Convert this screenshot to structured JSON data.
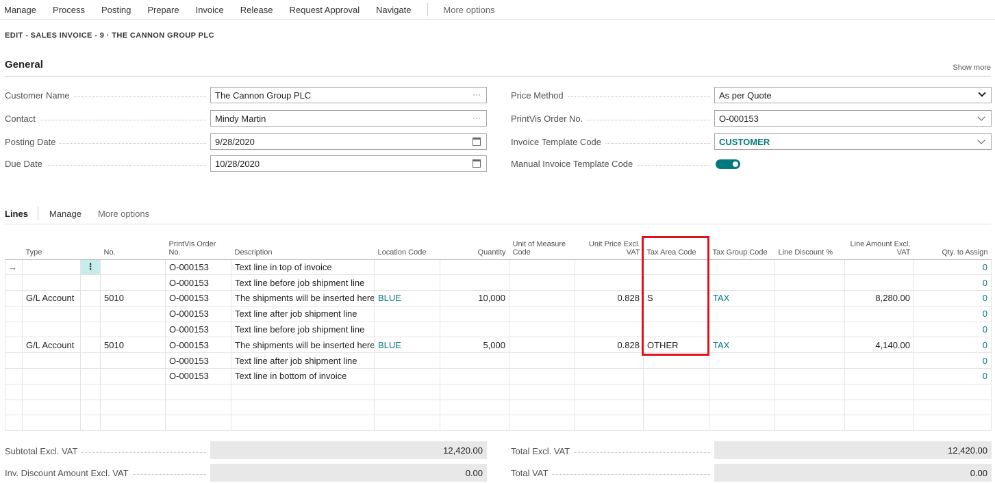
{
  "actions": [
    "Manage",
    "Process",
    "Posting",
    "Prepare",
    "Invoice",
    "Release",
    "Request Approval",
    "Navigate"
  ],
  "more_options": "More options",
  "page_title": "EDIT - SALES INVOICE - 9 · THE CANNON GROUP PLC",
  "general": {
    "title": "General",
    "show_more": "Show more",
    "customer_name": {
      "label": "Customer Name",
      "value": "The Cannon Group PLC"
    },
    "contact": {
      "label": "Contact",
      "value": "Mindy Martin"
    },
    "posting_date": {
      "label": "Posting Date",
      "value": "9/28/2020"
    },
    "due_date": {
      "label": "Due Date",
      "value": "10/28/2020"
    },
    "price_method": {
      "label": "Price Method",
      "value": "As per Quote"
    },
    "printvis_order": {
      "label": "PrintVis Order No.",
      "value": "O-000153"
    },
    "invoice_template": {
      "label": "Invoice Template Code",
      "value": "CUSTOMER"
    },
    "manual_invoice_template": {
      "label": "Manual Invoice Template Code",
      "value": true
    },
    "ellipsis": "···"
  },
  "lines": {
    "title": "Lines",
    "manage": "Manage",
    "more_options": "More options",
    "columns": {
      "type": "Type",
      "no": "No.",
      "printvis_a": "PrintVis Order",
      "printvis_b": "No.",
      "description": "Description",
      "location": "Location Code",
      "quantity": "Quantity",
      "uom_a": "Unit of Measure",
      "uom_b": "Code",
      "unit_price_a": "Unit Price Excl.",
      "unit_price_b": "VAT",
      "tax_area": "Tax Area Code",
      "tax_group": "Tax Group Code",
      "line_discount": "Line Discount %",
      "line_amount_a": "Line Amount Excl.",
      "line_amount_b": "VAT",
      "qty_assign": "Qty. to Assign"
    },
    "arrow": "→",
    "menu_glyph": "⋮",
    "rows": [
      {
        "type": "",
        "no": "",
        "order": "O-000153",
        "desc": "Text line in top of invoice",
        "loc": "",
        "qty": "",
        "uom": "",
        "price": "",
        "tax_area": "",
        "tax_group": "",
        "disc": "",
        "amount": "",
        "assign": "0"
      },
      {
        "type": "",
        "no": "",
        "order": "O-000153",
        "desc": "Text line before job shipment line",
        "loc": "",
        "qty": "",
        "uom": "",
        "price": "",
        "tax_area": "",
        "tax_group": "",
        "disc": "",
        "amount": "",
        "assign": "0"
      },
      {
        "type": "G/L Account",
        "no": "5010",
        "order": "O-000153",
        "desc": "The shipments will be inserted here",
        "loc": "BLUE",
        "qty": "10,000",
        "uom": "",
        "price": "0.828",
        "tax_area": "S",
        "tax_group": "TAX",
        "disc": "",
        "amount": "8,280.00",
        "assign": "0"
      },
      {
        "type": "",
        "no": "",
        "order": "O-000153",
        "desc": "Text line after job shipment line",
        "loc": "",
        "qty": "",
        "uom": "",
        "price": "",
        "tax_area": "",
        "tax_group": "",
        "disc": "",
        "amount": "",
        "assign": "0"
      },
      {
        "type": "",
        "no": "",
        "order": "O-000153",
        "desc": "Text line before job shipment line",
        "loc": "",
        "qty": "",
        "uom": "",
        "price": "",
        "tax_area": "",
        "tax_group": "",
        "disc": "",
        "amount": "",
        "assign": "0"
      },
      {
        "type": "G/L Account",
        "no": "5010",
        "order": "O-000153",
        "desc": "The shipments will be inserted here",
        "loc": "BLUE",
        "qty": "5,000",
        "uom": "",
        "price": "0.828",
        "tax_area": "OTHER",
        "tax_group": "TAX",
        "disc": "",
        "amount": "4,140.00",
        "assign": "0"
      },
      {
        "type": "",
        "no": "",
        "order": "O-000153",
        "desc": "Text line after job shipment line",
        "loc": "",
        "qty": "",
        "uom": "",
        "price": "",
        "tax_area": "",
        "tax_group": "",
        "disc": "",
        "amount": "",
        "assign": "0"
      },
      {
        "type": "",
        "no": "",
        "order": "O-000153",
        "desc": "Text line in bottom of invoice",
        "loc": "",
        "qty": "",
        "uom": "",
        "price": "",
        "tax_area": "",
        "tax_group": "",
        "disc": "",
        "amount": "",
        "assign": "0"
      }
    ]
  },
  "totals": {
    "subtotal": {
      "label": "Subtotal Excl. VAT",
      "value": "12,420.00"
    },
    "inv_discount": {
      "label": "Inv. Discount Amount Excl. VAT",
      "value": "0.00"
    },
    "total_excl": {
      "label": "Total Excl. VAT",
      "value": "12,420.00"
    },
    "total_vat": {
      "label": "Total VAT",
      "value": "0.00"
    }
  },
  "colors": {
    "accent": "#00797f",
    "highlight": "#e0101c",
    "row_menu": "#c6ecee"
  }
}
